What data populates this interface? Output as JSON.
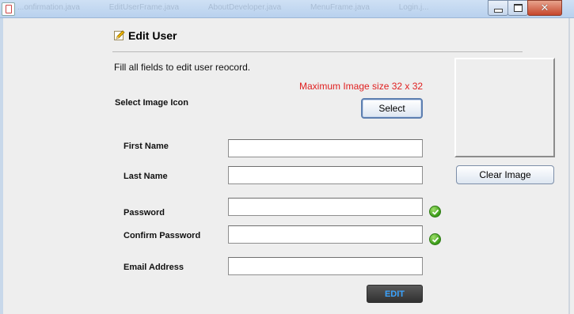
{
  "window": {
    "background_tabs": [
      "...onfirmation.java",
      "EditUserFrame.java",
      "AboutDeveloper.java",
      "MenuFrame.java",
      "Login.j..."
    ],
    "controls": {
      "minimize": "minimize",
      "maximize": "maximize",
      "close": "✕"
    }
  },
  "form": {
    "title": "Edit User",
    "title_icon": "pencil-icon",
    "instruction": "Fill all fields to edit user reocord.",
    "image_hint": "Maximum Image size 32 x 32",
    "select_icon_label": "Select Image Icon",
    "select_button": "Select",
    "clear_image_button": "Clear Image",
    "fields": {
      "first_name_label": "First Name",
      "last_name_label": "Last Name",
      "password_label": "Password",
      "confirm_password_label": "Confirm Password",
      "email_label": "Email Address"
    },
    "values": {
      "first_name": "",
      "last_name": "",
      "password": "",
      "confirm_password": "",
      "email": ""
    },
    "edit_button": "EDIT"
  },
  "colors": {
    "hint_text": "#e02020",
    "edit_text": "#3aa3ff",
    "check": "#3a9b18"
  }
}
